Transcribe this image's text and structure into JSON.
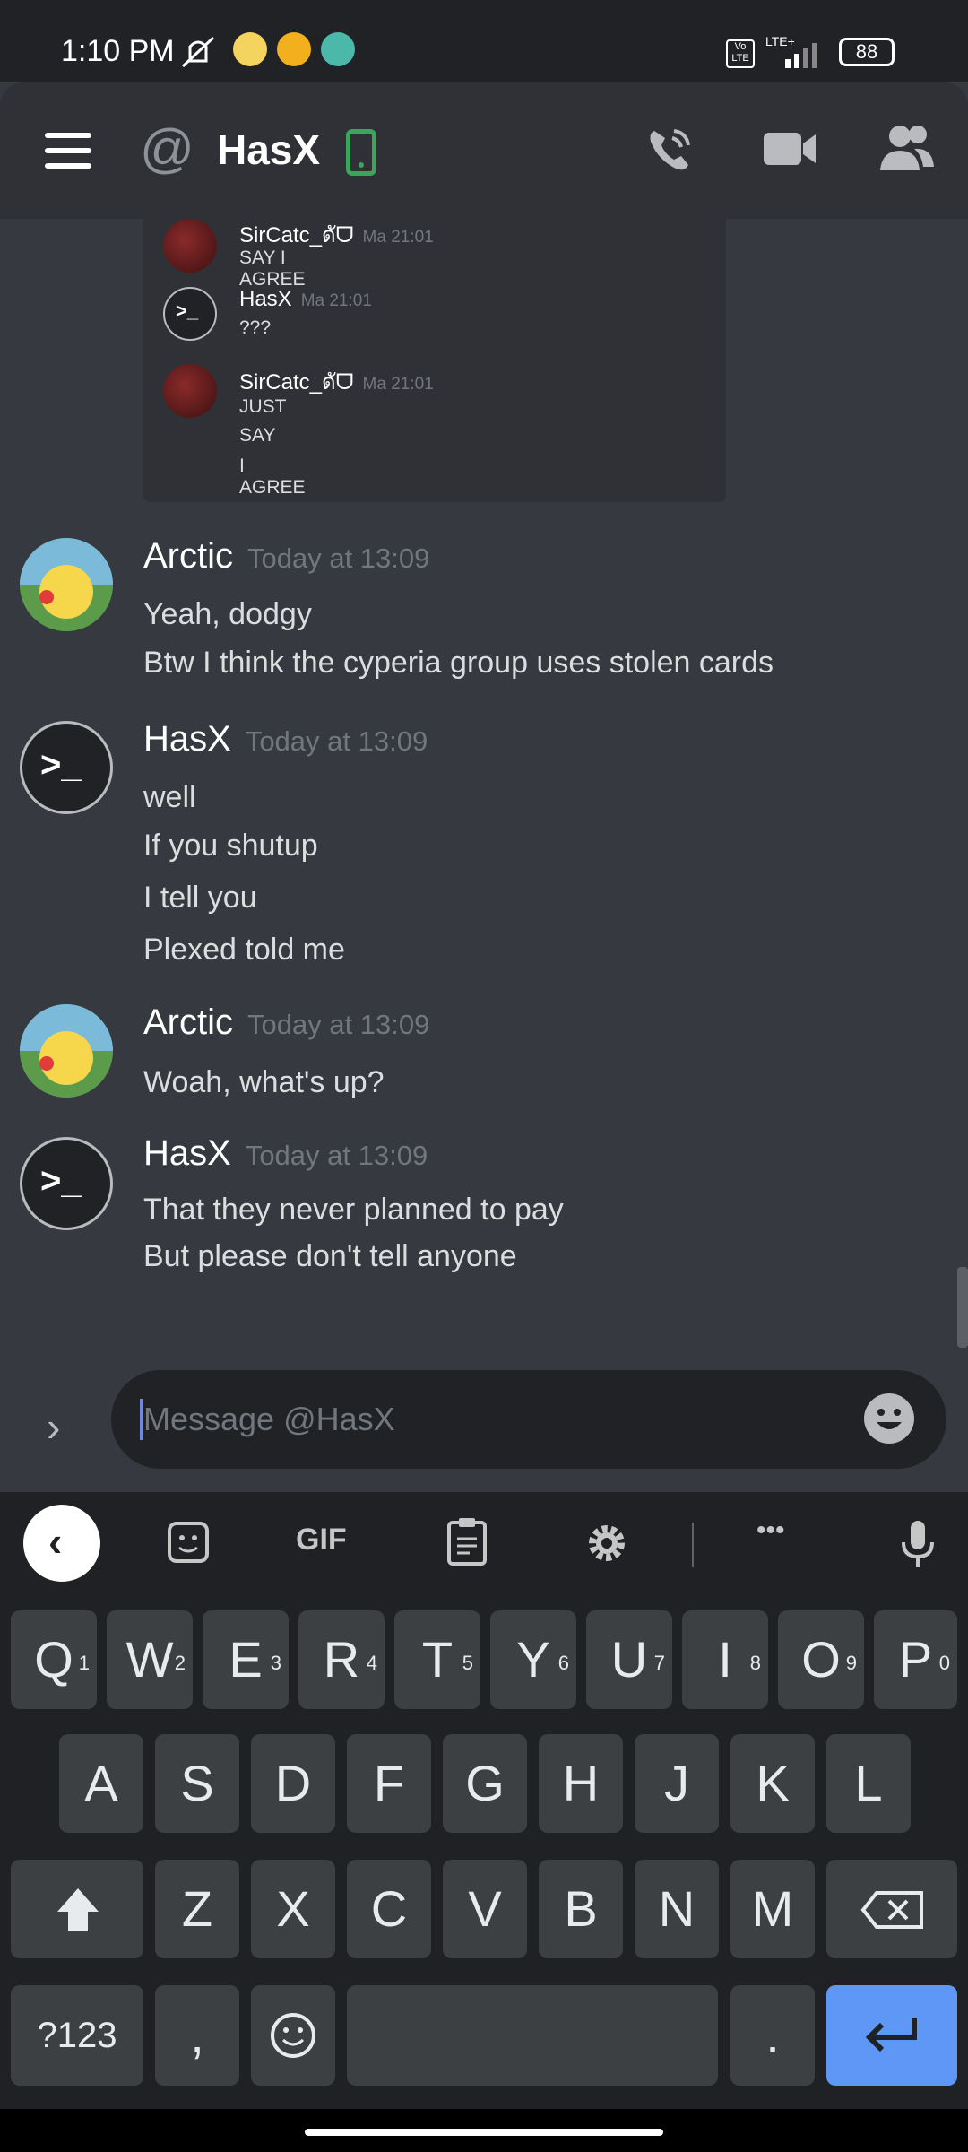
{
  "status_bar": {
    "time": "1:10 PM",
    "battery": "88",
    "network": "LTE+",
    "volte": "Vo LTE"
  },
  "header": {
    "at_symbol": "@",
    "title": "HasX"
  },
  "quoted_thread": [
    {
      "author": "SirCatc_ดัᗜ",
      "time": "Ma 21:01",
      "lines": [
        "SAY I AGREE"
      ]
    },
    {
      "author": "HasX",
      "time": "Ma 21:01",
      "lines": [
        "???"
      ]
    },
    {
      "author": "SirCatc_ดัᗜ",
      "time": "Ma 21:01",
      "lines": [
        "JUST",
        "SAY",
        "I AGREE"
      ]
    }
  ],
  "messages": [
    {
      "author": "Arctic",
      "time": "Today at 13:09",
      "lines": [
        "Yeah, dodgy",
        "Btw I think the cyperia group uses stolen cards"
      ]
    },
    {
      "author": "HasX",
      "time": "Today at 13:09",
      "lines": [
        "well",
        "If you shutup",
        "I tell you",
        "Plexed told me"
      ]
    },
    {
      "author": "Arctic",
      "time": "Today at 13:09",
      "lines": [
        "Woah, what's up?"
      ]
    },
    {
      "author": "HasX",
      "time": "Today at 13:09",
      "lines": [
        "That they never planned to pay",
        "But please don't tell anyone"
      ]
    }
  ],
  "input": {
    "placeholder": "Message @HasX",
    "value": ""
  },
  "keyboard": {
    "toolbar": {
      "gif": "GIF",
      "more": "•••"
    },
    "row1": [
      {
        "k": "Q",
        "n": "1"
      },
      {
        "k": "W",
        "n": "2"
      },
      {
        "k": "E",
        "n": "3"
      },
      {
        "k": "R",
        "n": "4"
      },
      {
        "k": "T",
        "n": "5"
      },
      {
        "k": "Y",
        "n": "6"
      },
      {
        "k": "U",
        "n": "7"
      },
      {
        "k": "I",
        "n": "8"
      },
      {
        "k": "O",
        "n": "9"
      },
      {
        "k": "P",
        "n": "0"
      }
    ],
    "row2": [
      "A",
      "S",
      "D",
      "F",
      "G",
      "H",
      "J",
      "K",
      "L"
    ],
    "row3": [
      "Z",
      "X",
      "C",
      "V",
      "B",
      "N",
      "M"
    ],
    "symbols": "?123",
    "comma": ",",
    "period": "."
  },
  "colors": {
    "background": "#36393f",
    "header": "#2f3136",
    "accent": "#7289da",
    "online": "#3ba55c",
    "enter_key": "#5e97f6"
  }
}
